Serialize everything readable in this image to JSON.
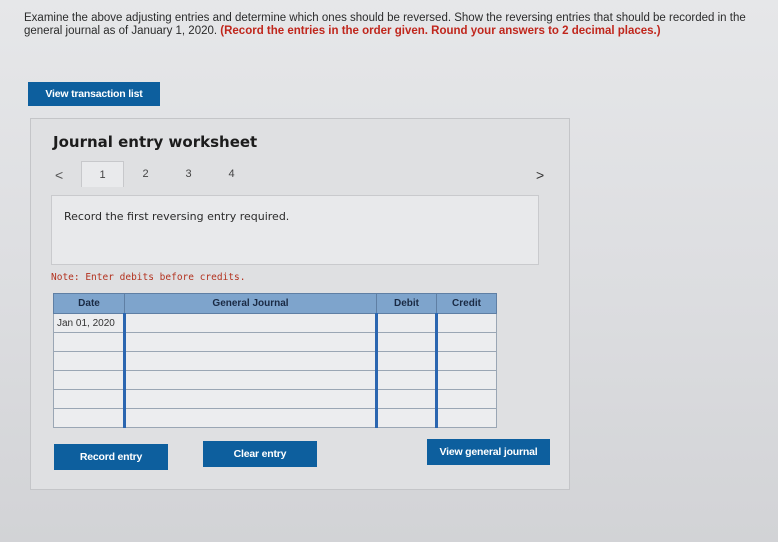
{
  "instructions": {
    "text": "Examine the above adjusting entries and determine which ones should be reversed. Show the reversing entries that should be recorded in the general journal as of January 1, 2020.",
    "emphasis": "(Record the entries in the order given. Round your answers to 2 decimal places.)"
  },
  "buttons": {
    "view_transaction_list": "View transaction list",
    "record_entry": "Record entry",
    "clear_entry": "Clear entry",
    "view_general_journal": "View general journal"
  },
  "worksheet": {
    "title": "Journal entry worksheet",
    "tabs": [
      "1",
      "2",
      "3",
      "4"
    ],
    "active_tab": "1",
    "prev_icon": "<",
    "next_icon": ">",
    "prompt": "Record the first reversing entry required.",
    "note": "Note: Enter debits before credits."
  },
  "table": {
    "headers": [
      "Date",
      "General Journal",
      "Debit",
      "Credit"
    ],
    "rows": [
      [
        "Jan 01, 2020",
        "",
        "",
        ""
      ],
      [
        "",
        "",
        "",
        ""
      ],
      [
        "",
        "",
        "",
        ""
      ],
      [
        "",
        "",
        "",
        ""
      ],
      [
        "",
        "",
        "",
        ""
      ],
      [
        "",
        "",
        "",
        ""
      ]
    ]
  },
  "colors": {
    "accent_button": "#0d5f9e",
    "table_header": "#7ea4cc",
    "note_red": "#b3321f"
  }
}
